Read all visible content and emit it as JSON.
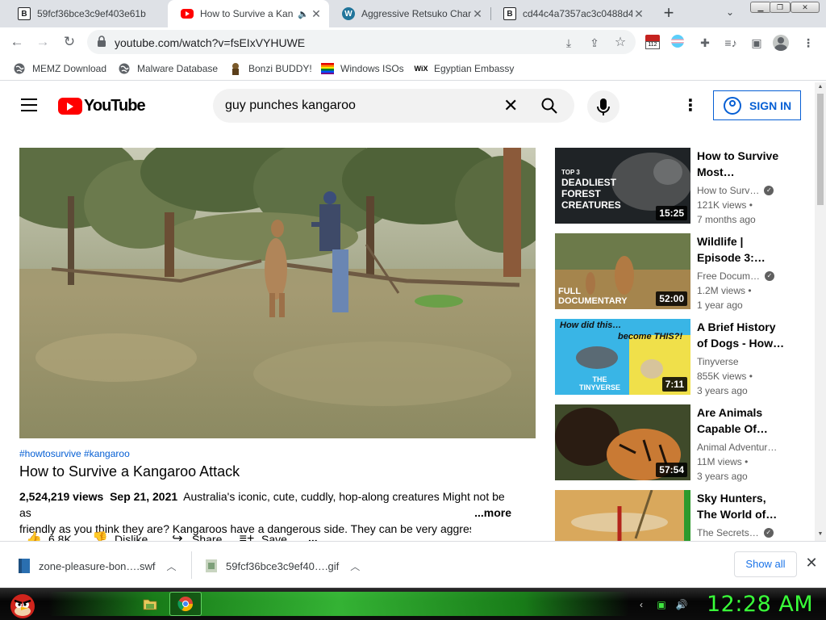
{
  "browser": {
    "tabs": [
      {
        "title": "59fcf36bce3c9ef403e61b",
        "favicon": "b-square-icon"
      },
      {
        "title": "How to Survive a Kan",
        "favicon": "youtube-icon",
        "active": true,
        "audio": true
      },
      {
        "title": "Aggressive Retsuko Chara",
        "favicon": "wordpress-icon"
      },
      {
        "title": "cd44c4a7357ac3c0488d4",
        "favicon": "b-square-icon"
      }
    ],
    "url": "youtube.com/watch?v=fsEIxVYHUWE",
    "bookmarks": [
      {
        "label": "MEMZ Download",
        "icon": "globe-icon"
      },
      {
        "label": "Malware Database",
        "icon": "globe-icon"
      },
      {
        "label": "Bonzi BUDDY!",
        "icon": "bonzi-icon"
      },
      {
        "label": "Windows ISOs",
        "icon": "windows-flag-icon"
      },
      {
        "label": "Egyptian Embassy",
        "icon": "wix-icon"
      }
    ],
    "bookmark_wix": "WiX",
    "ext_badge": "112"
  },
  "youtube": {
    "logo": "YouTube",
    "search_query": "guy punches kangaroo",
    "sign_in": "SIGN IN",
    "video": {
      "hashtags": "#howtosurvive #kangaroo",
      "title": "How to Survive a Kangaroo Attack",
      "views": "2,524,219 views",
      "date": "Sep 21, 2021",
      "desc_line1": "Australia's iconic, cute, cuddly, hop-along creatures Might not be as",
      "desc_line2": "friendly as you think they are? Kangaroos have a dangerous side. They can be very aggress",
      "more": "...more",
      "likes": "6.8K",
      "dislike": "Dislike",
      "share": "Share",
      "save": "Save",
      "more_actions": "..."
    },
    "suggestions": [
      {
        "title1": "How to Survive",
        "title2": "Most…",
        "channel": "How to Surv…",
        "views": "121K views •",
        "age": "7 months ago",
        "duration": "15:25",
        "thumb_text1": "TOP 3",
        "thumb_text2": "DEADLIEST",
        "thumb_text3": "FOREST",
        "thumb_text4": "CREATURES"
      },
      {
        "title1": "Wildlife |",
        "title2": "Episode 3:…",
        "channel": "Free Docum…",
        "views": "1.2M views •",
        "age": "1 year ago",
        "duration": "52:00",
        "thumb_text1": "FULL",
        "thumb_text2": "DOCUMENTARY"
      },
      {
        "title1": "A Brief History",
        "title2": "of Dogs - How…",
        "channel": "Tinyverse",
        "views": "855K views •",
        "age": "3 years ago",
        "duration": "7:11",
        "thumb_text1": "How did this…",
        "thumb_text2": "become THIS?!",
        "thumb_text3": "THE",
        "thumb_text4": "TINYVERSE"
      },
      {
        "title1": "Are Animals",
        "title2": "Capable Of…",
        "channel": "Animal Adventur…",
        "views": "11M views •",
        "age": "3 years ago",
        "duration": "57:54"
      },
      {
        "title1": "Sky Hunters,",
        "title2": "The World of…",
        "channel": "The Secrets…",
        "views": "",
        "age": "",
        "duration": ""
      }
    ]
  },
  "downloads": {
    "items": [
      {
        "name": "zone-pleasure-bon….swf"
      },
      {
        "name": "59fcf36bce3c9ef40….gif"
      }
    ],
    "show_all": "Show all"
  },
  "taskbar": {
    "clock": "12:28 AM"
  }
}
